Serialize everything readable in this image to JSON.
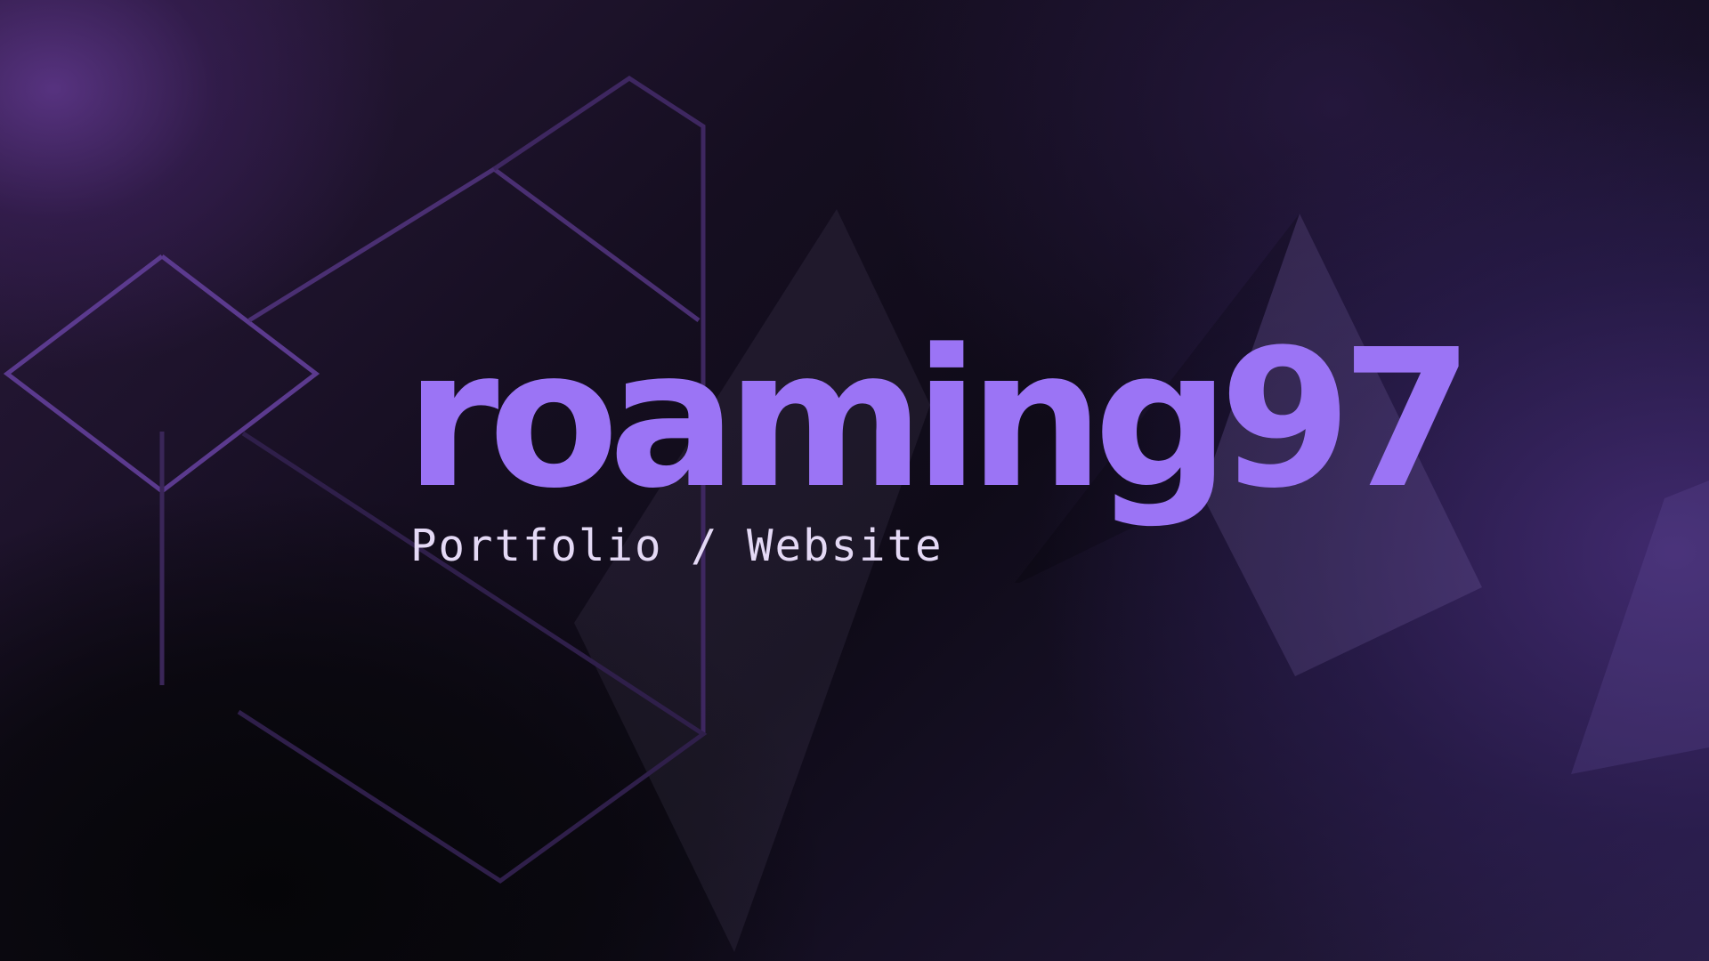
{
  "brand": {
    "title": "roaming97",
    "tagline": "Portfolio / Website"
  },
  "colors": {
    "accent": "#9b74f5",
    "tagline": "#e4d9f5",
    "line_decor": "#5b3a8e",
    "background_dark": "#0b0910",
    "background_purple": "#2a1f48"
  }
}
